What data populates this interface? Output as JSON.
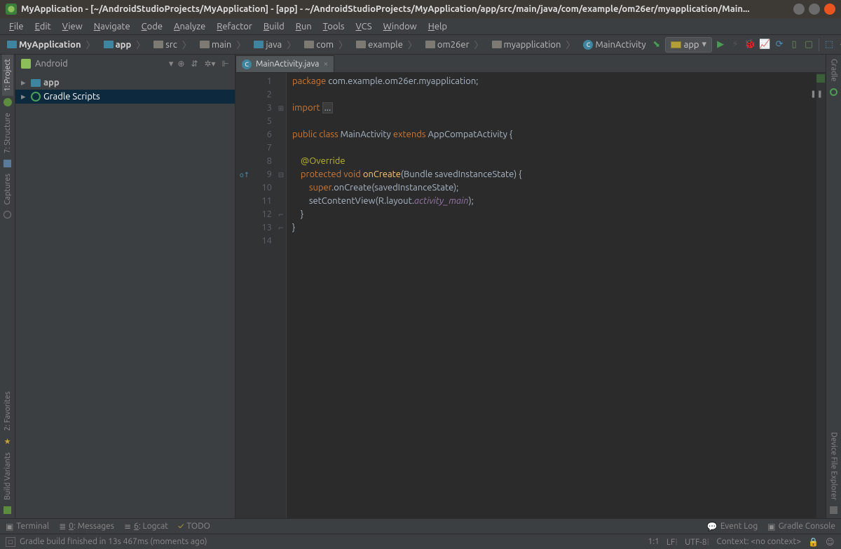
{
  "titlebar": "MyApplication - [~/AndroidStudioProjects/MyApplication] - [app] - ~/AndroidStudioProjects/MyApplication/app/src/main/java/com/example/om26er/myapplication/Main...",
  "menus": [
    "File",
    "Edit",
    "View",
    "Navigate",
    "Code",
    "Analyze",
    "Refactor",
    "Build",
    "Run",
    "Tools",
    "VCS",
    "Window",
    "Help"
  ],
  "breadcrumbs": [
    {
      "label": "MyApplication",
      "bold": true,
      "iconColor": "blue"
    },
    {
      "label": "app",
      "bold": true,
      "iconColor": "blue"
    },
    {
      "label": "src"
    },
    {
      "label": "main"
    },
    {
      "label": "java",
      "iconColor": "blue"
    },
    {
      "label": "com"
    },
    {
      "label": "example"
    },
    {
      "label": "om26er"
    },
    {
      "label": "myapplication"
    },
    {
      "label": "MainActivity",
      "isClass": true
    }
  ],
  "run_config": {
    "label": "app"
  },
  "project": {
    "view_label": "Android",
    "roots": [
      {
        "label": "app",
        "icon": "folder-blue"
      },
      {
        "label": "Gradle Scripts",
        "icon": "gradle",
        "selected": true
      }
    ]
  },
  "tabs": [
    {
      "label": "MainActivity.java",
      "icon": "class"
    }
  ],
  "code": {
    "lines": [
      {
        "n": 1,
        "html": "<span class='kw'>package</span> com.example.om26er.myapplication;"
      },
      {
        "n": 2,
        "html": ""
      },
      {
        "n": 3,
        "html": "<span class='kw'>import</span> <span class='collapsed-import'>...</span>",
        "fold": "+"
      },
      {
        "n": 5,
        "html": ""
      },
      {
        "n": 6,
        "html": "<span class='kw'>public class</span> MainActivity <span class='kw'>extends</span> AppCompatActivity {"
      },
      {
        "n": 7,
        "html": ""
      },
      {
        "n": 8,
        "html": "    <span class='ann'>@Override</span>"
      },
      {
        "n": 9,
        "html": "    <span class='kw'>protected void</span> <span class='fn'>onCreate</span>(Bundle savedInstanceState) {",
        "fold": "-",
        "gutter": "override"
      },
      {
        "n": 10,
        "html": "        <span class='kw'>super</span>.onCreate(savedInstanceState);"
      },
      {
        "n": 11,
        "html": "        setContentView(R.layout.<span class='it'>activity_main</span>);"
      },
      {
        "n": 12,
        "html": "    }",
        "fold": "e"
      },
      {
        "n": 13,
        "html": "}",
        "fold": "e"
      },
      {
        "n": 14,
        "html": ""
      }
    ]
  },
  "left_rail": [
    {
      "label": "1: Project",
      "active": true
    },
    {
      "label": "7: Structure"
    },
    {
      "label": "Captures"
    },
    {
      "label": "2: Favorites"
    },
    {
      "label": "Build Variants"
    }
  ],
  "right_rail": [
    {
      "label": "Gradle"
    },
    {
      "label": "Device File Explorer"
    }
  ],
  "bottom_bar": {
    "terminal": "Terminal",
    "messages": "0: Messages",
    "logcat": "6: Logcat",
    "todo": "TODO",
    "event_log": "Event Log",
    "gradle_console": "Gradle Console"
  },
  "status": {
    "message": "Gradle build finished in 13s 467ms (moments ago)",
    "pos": "1:1",
    "eol": "LF",
    "enc": "UTF-8",
    "ctx": "Context: <no context>"
  }
}
